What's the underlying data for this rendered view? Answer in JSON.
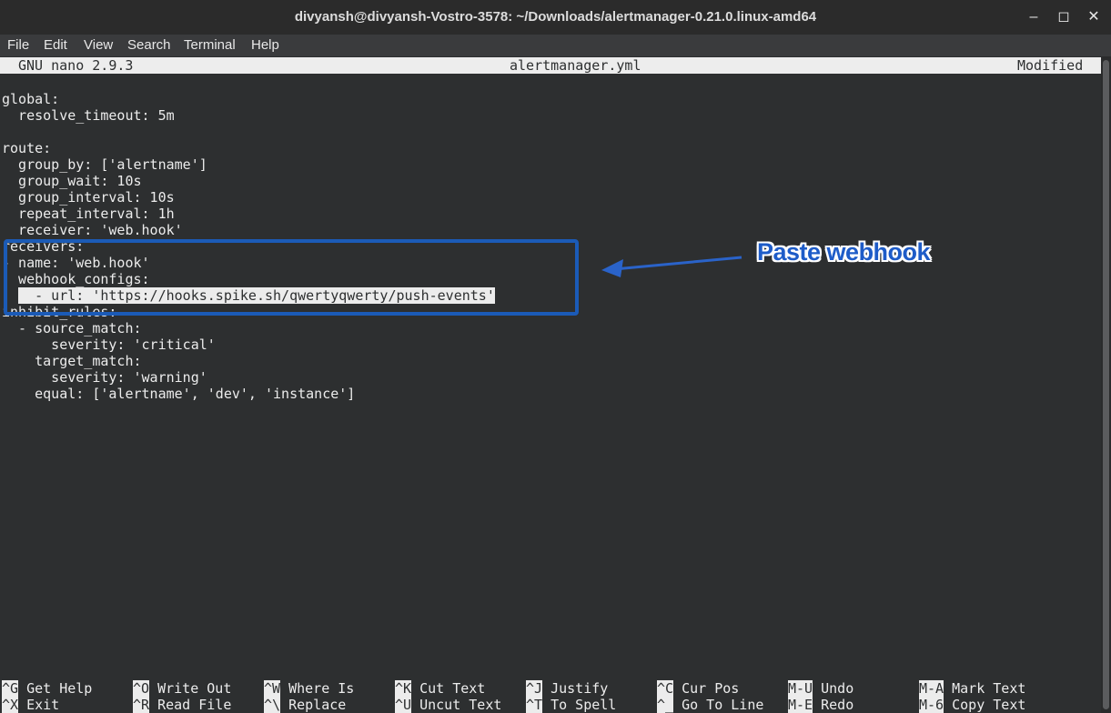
{
  "window": {
    "title": "divyansh@divyansh-Vostro-3578: ~/Downloads/alertmanager-0.21.0.linux-amd64"
  },
  "menu": [
    "File",
    "Edit",
    "View",
    "Search",
    "Terminal",
    "Help"
  ],
  "nano": {
    "version": "GNU nano 2.9.3",
    "filename": "alertmanager.yml",
    "status": "Modified"
  },
  "lines": [
    "global:",
    "  resolve_timeout: 5m",
    "",
    "route:",
    "  group_by: ['alertname']",
    "  group_wait: 10s",
    "  group_interval: 10s",
    "  repeat_interval: 1h",
    "  receiver: 'web.hook'",
    "receivers:",
    "- name: 'web.hook'",
    "  webhook_configs:",
    "  - url: 'https://hooks.spike.sh/qwertyqwerty/push-events'",
    "inhibit_rules:",
    "  - source_match:",
    "      severity: 'critical'",
    "    target_match:",
    "      severity: 'warning'",
    "    equal: ['alertname', 'dev', 'instance']"
  ],
  "highlighted_line": "  - url: 'https://hooks.spike.sh/qwertyqwerty/push-events'",
  "shortcuts_row1": [
    {
      "key": "^G",
      "label": "Get Help"
    },
    {
      "key": "^O",
      "label": "Write Out"
    },
    {
      "key": "^W",
      "label": "Where Is"
    },
    {
      "key": "^K",
      "label": "Cut Text"
    },
    {
      "key": "^J",
      "label": "Justify"
    },
    {
      "key": "^C",
      "label": "Cur Pos"
    },
    {
      "key": "M-U",
      "label": "Undo"
    },
    {
      "key": "M-A",
      "label": "Mark Text"
    }
  ],
  "shortcuts_row2": [
    {
      "key": "^X",
      "label": "Exit"
    },
    {
      "key": "^R",
      "label": "Read File"
    },
    {
      "key": "^\\",
      "label": "Replace"
    },
    {
      "key": "^U",
      "label": "Uncut Text"
    },
    {
      "key": "^T",
      "label": "To Spell"
    },
    {
      "key": "^_",
      "label": "Go To Line"
    },
    {
      "key": "M-E",
      "label": "Redo"
    },
    {
      "key": "M-6",
      "label": "Copy Text"
    }
  ],
  "annotation": {
    "text": "Paste webhook",
    "color": "#1e5cc8"
  }
}
